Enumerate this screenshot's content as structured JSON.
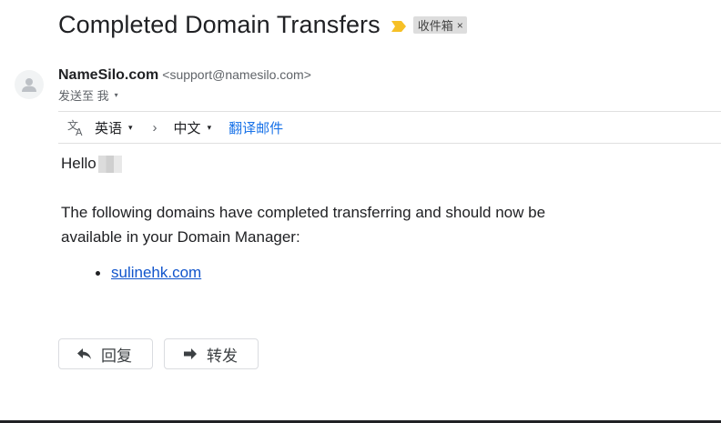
{
  "email": {
    "subject": "Completed Domain Transfers",
    "label": "收件箱",
    "label_close": "×",
    "sender_name": "NameSilo.com",
    "sender_email": "<support@namesilo.com>",
    "to_text": "发送至 我",
    "caret": "▾"
  },
  "translate": {
    "source_lang": "英语",
    "arrow": "›",
    "target_lang": "中文",
    "translate_link": "翻译邮件",
    "caret": "▾"
  },
  "body": {
    "greeting": "Hello",
    "paragraph_line1": "The following domains have completed transferring and should now be",
    "paragraph_line2": "available in your Domain Manager:",
    "domains": [
      "sulinehk.com"
    ]
  },
  "actions": {
    "reply_label": "回复",
    "forward_label": "转发"
  },
  "colors": {
    "link": "#1155cc",
    "translate_link": "#1a73e8",
    "importance_marker": "#f6c026",
    "label_bg": "#dddddd"
  }
}
